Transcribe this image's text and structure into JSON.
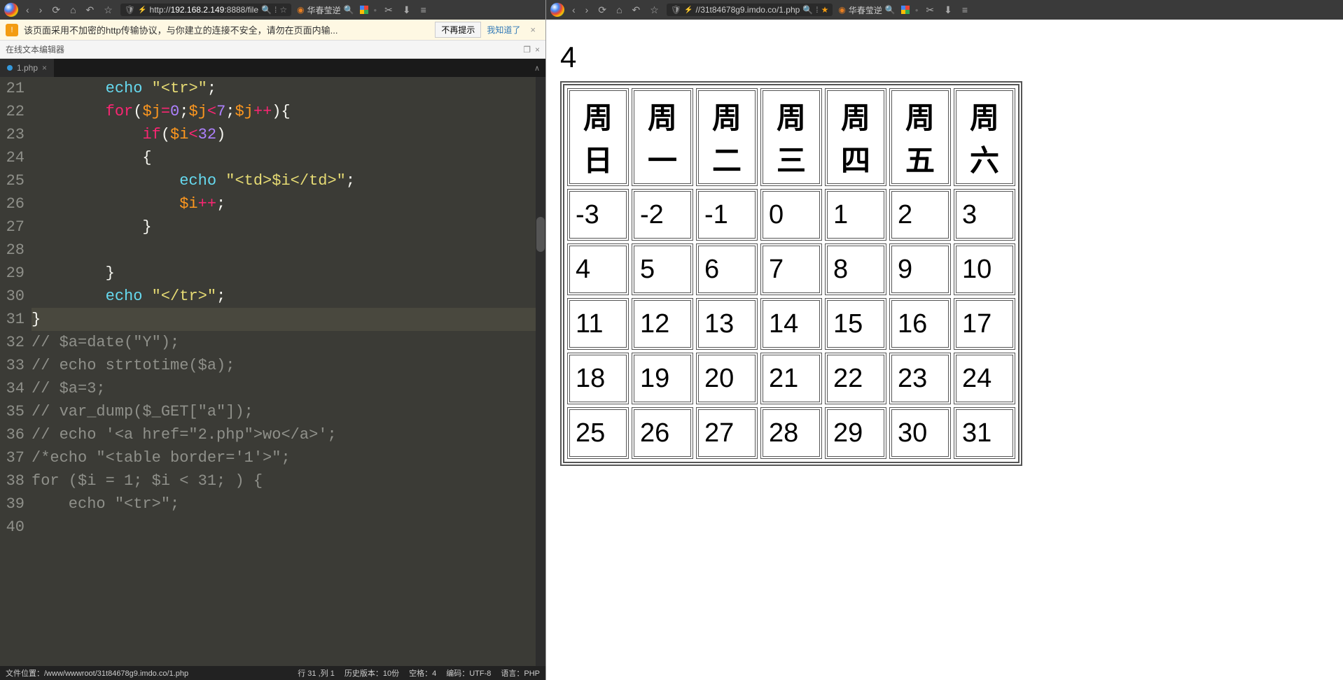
{
  "left": {
    "chrome": {
      "url_prefix": "http://",
      "url_host": "192.168.2.149",
      "url_port": ":8888",
      "url_path": "/file",
      "search_label": "华春莹逆"
    },
    "warning": {
      "text": "该页面采用不加密的http传输协议，与你建立的连接不安全，请勿在页面内输...",
      "btn_dismiss": "不再提示",
      "btn_ok": "我知道了"
    },
    "title": "在线文本编辑器",
    "tab": {
      "name": "1.php"
    },
    "code": {
      "lines": [
        {
          "n": "21",
          "seg": [
            {
              "c": "k-w",
              "t": "        "
            },
            {
              "c": "k-f",
              "t": "echo"
            },
            {
              "c": "k-w",
              "t": " "
            },
            {
              "c": "k-s",
              "t": "\"<tr>\""
            },
            {
              "c": "k-w",
              "t": ";"
            }
          ]
        },
        {
          "n": "22",
          "seg": [
            {
              "c": "k-w",
              "t": "        "
            },
            {
              "c": "k-k",
              "t": "for"
            },
            {
              "c": "k-w",
              "t": "("
            },
            {
              "c": "k-v",
              "t": "$j"
            },
            {
              "c": "k-o",
              "t": "="
            },
            {
              "c": "k-n",
              "t": "0"
            },
            {
              "c": "k-w",
              "t": ";"
            },
            {
              "c": "k-v",
              "t": "$j"
            },
            {
              "c": "k-o",
              "t": "<"
            },
            {
              "c": "k-n",
              "t": "7"
            },
            {
              "c": "k-w",
              "t": ";"
            },
            {
              "c": "k-v",
              "t": "$j"
            },
            {
              "c": "k-o",
              "t": "++"
            },
            {
              "c": "k-w",
              "t": "){"
            }
          ]
        },
        {
          "n": "23",
          "seg": [
            {
              "c": "k-w",
              "t": "            "
            },
            {
              "c": "k-k",
              "t": "if"
            },
            {
              "c": "k-w",
              "t": "("
            },
            {
              "c": "k-v",
              "t": "$i"
            },
            {
              "c": "k-o",
              "t": "<"
            },
            {
              "c": "k-n",
              "t": "32"
            },
            {
              "c": "k-w",
              "t": ")"
            }
          ]
        },
        {
          "n": "24",
          "seg": [
            {
              "c": "k-w",
              "t": "            {"
            }
          ]
        },
        {
          "n": "25",
          "seg": [
            {
              "c": "k-w",
              "t": "                "
            },
            {
              "c": "k-f",
              "t": "echo"
            },
            {
              "c": "k-w",
              "t": " "
            },
            {
              "c": "k-s",
              "t": "\"<td>$i</td>\""
            },
            {
              "c": "k-w",
              "t": ";"
            }
          ]
        },
        {
          "n": "26",
          "seg": [
            {
              "c": "k-w",
              "t": "                "
            },
            {
              "c": "k-v",
              "t": "$i"
            },
            {
              "c": "k-o",
              "t": "++"
            },
            {
              "c": "k-w",
              "t": ";"
            }
          ]
        },
        {
          "n": "27",
          "seg": [
            {
              "c": "k-w",
              "t": "            }"
            }
          ]
        },
        {
          "n": "28",
          "seg": [
            {
              "c": "k-w",
              "t": ""
            }
          ]
        },
        {
          "n": "29",
          "seg": [
            {
              "c": "k-w",
              "t": "        }"
            }
          ]
        },
        {
          "n": "30",
          "seg": [
            {
              "c": "k-w",
              "t": "        "
            },
            {
              "c": "k-f",
              "t": "echo"
            },
            {
              "c": "k-w",
              "t": " "
            },
            {
              "c": "k-s",
              "t": "\"</tr>\""
            },
            {
              "c": "k-w",
              "t": ";"
            }
          ]
        },
        {
          "n": "31",
          "hl": true,
          "seg": [
            {
              "c": "k-w",
              "t": "}"
            }
          ]
        },
        {
          "n": "32",
          "seg": [
            {
              "c": "k-c",
              "t": "// $a=date(\"Y\");"
            }
          ]
        },
        {
          "n": "33",
          "seg": [
            {
              "c": "k-c",
              "t": "// echo strtotime($a);"
            }
          ]
        },
        {
          "n": "34",
          "seg": [
            {
              "c": "k-c",
              "t": "// $a=3;"
            }
          ]
        },
        {
          "n": "35",
          "seg": [
            {
              "c": "k-c",
              "t": "// var_dump($_GET[\"a\"]);"
            }
          ]
        },
        {
          "n": "36",
          "seg": [
            {
              "c": "k-c",
              "t": "// echo '<a href=\"2.php\">wo</a>';"
            }
          ]
        },
        {
          "n": "37",
          "seg": [
            {
              "c": "k-c",
              "t": "/*echo \"<table border='1'>\";"
            }
          ]
        },
        {
          "n": "38",
          "seg": [
            {
              "c": "k-c",
              "t": "for ($i = 1; $i < 31; ) {"
            }
          ]
        },
        {
          "n": "39",
          "seg": [
            {
              "c": "k-c",
              "t": "    echo \"<tr>\";"
            }
          ]
        },
        {
          "n": "40",
          "seg": [
            {
              "c": "k-c",
              "t": ""
            }
          ]
        }
      ]
    },
    "status": {
      "path": "文件位置：/www/wwwroot/31t84678g9.imdo.co/1.php",
      "pos": "行 31 ,列 1",
      "history": "历史版本：10份",
      "spaces": "空格：4",
      "encoding": "编码：UTF-8",
      "lang": "语言：PHP"
    }
  },
  "right": {
    "chrome": {
      "url": "//31t84678g9.imdo.co/1.php",
      "search_label": "华春莹逆"
    },
    "page": {
      "heading": "4",
      "headers": [
        "周日",
        "周一",
        "周二",
        "周三",
        "周四",
        "周五",
        "周六"
      ],
      "rows": [
        [
          "-3",
          "-2",
          "-1",
          "0",
          "1",
          "2",
          "3"
        ],
        [
          "4",
          "5",
          "6",
          "7",
          "8",
          "9",
          "10"
        ],
        [
          "11",
          "12",
          "13",
          "14",
          "15",
          "16",
          "17"
        ],
        [
          "18",
          "19",
          "20",
          "21",
          "22",
          "23",
          "24"
        ],
        [
          "25",
          "26",
          "27",
          "28",
          "29",
          "30",
          "31"
        ]
      ]
    }
  }
}
